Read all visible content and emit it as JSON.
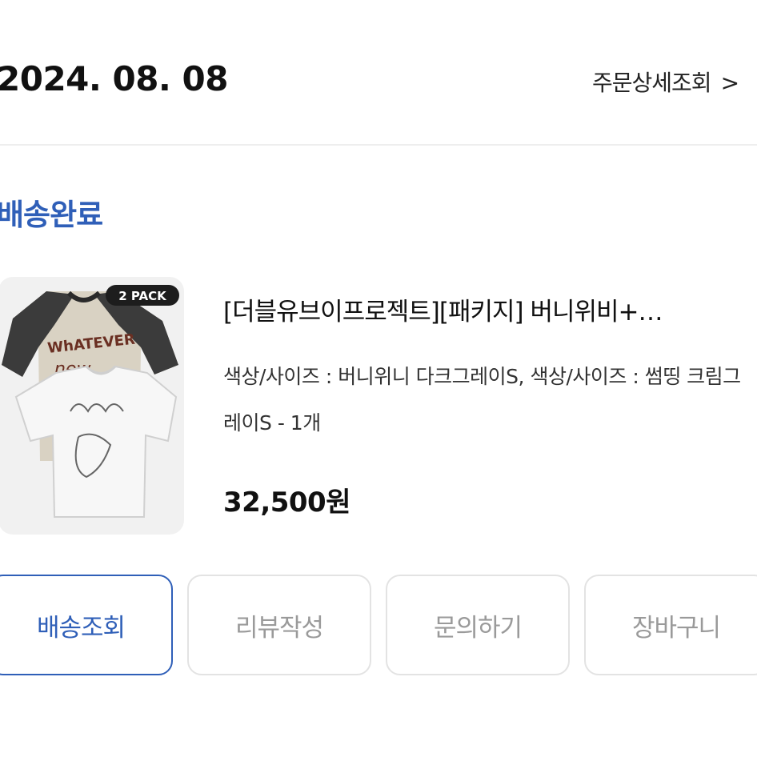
{
  "order": {
    "date": "2024. 08. 08",
    "detail_link": "주문상세조회",
    "detail_chevron": ">"
  },
  "status": {
    "label": "배송완료"
  },
  "product": {
    "badge": "2 PACK",
    "name": "[더블유브이프로젝트][패키지] 버니위비+…",
    "option": "색상/사이즈 : 버니위니 다크그레이S, 색상/사이즈 : 썸띵 크림그레이S - 1개",
    "price": "32,500원",
    "image_icon": "tshirt-pack-image"
  },
  "actions": {
    "track": "배송조회",
    "review": "리뷰작성",
    "inquiry": "문의하기",
    "cart": "장바구니"
  },
  "colors": {
    "accent": "#2f5fb8",
    "muted_text": "#9a9a9a",
    "border": "#e3e3e3"
  }
}
